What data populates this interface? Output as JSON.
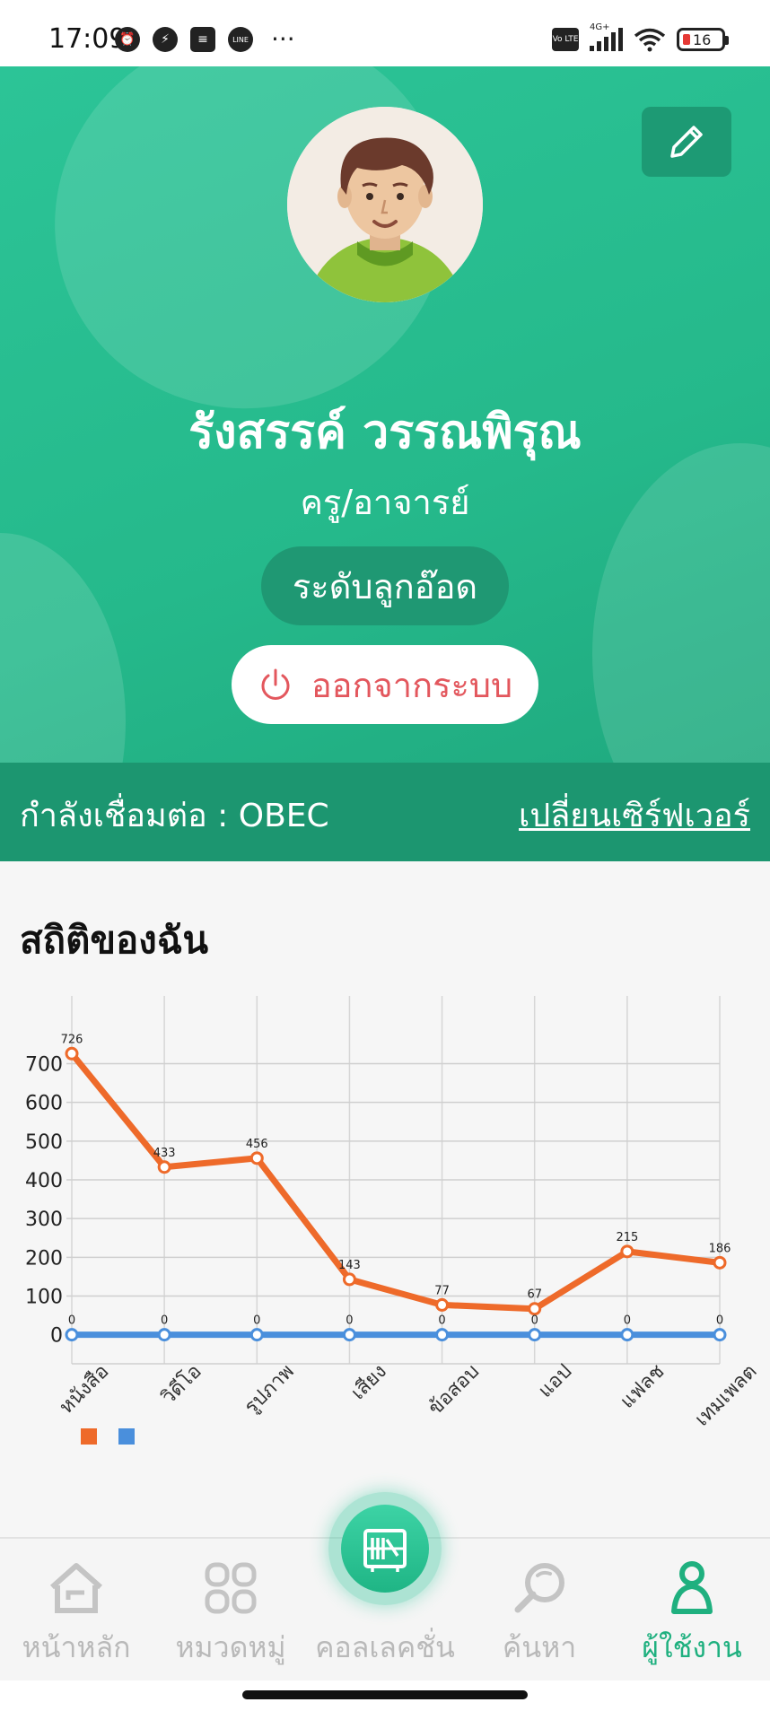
{
  "status_bar": {
    "time": "17:09",
    "left_icons": [
      "alarm-icon",
      "messenger-icon",
      "notes-icon",
      "line-icon"
    ],
    "more": "···",
    "volte": "Vo LTE",
    "network": "4G+",
    "battery": "16"
  },
  "profile": {
    "name": "รังสรรค์ วรรณพิรุณ",
    "role": "ครู/อาจารย์",
    "level": "ระดับลูกอ๊อด",
    "logout_label": "ออกจากระบบ"
  },
  "connection": {
    "label": "กำลังเชื่อมต่อ : OBEC",
    "switch_server": "เปลี่ยนเซิร์ฟเวอร์"
  },
  "stats": {
    "title": "สถิติของฉัน"
  },
  "chart_data": {
    "type": "line",
    "categories": [
      "หนังสือ",
      "วิดีโอ",
      "รูปภาพ",
      "เสียง",
      "ข้อสอบ",
      "แอป",
      "แฟลช",
      "เทมเพลต"
    ],
    "series": [
      {
        "values": [
          726,
          433,
          456,
          143,
          77,
          67,
          215,
          186
        ],
        "color": "#ee6a2a"
      },
      {
        "values": [
          0,
          0,
          0,
          0,
          0,
          0,
          0,
          0
        ],
        "color": "#4a8fdc"
      }
    ],
    "y_ticks": [
      0,
      100,
      200,
      300,
      400,
      500,
      600,
      700
    ],
    "ylim": [
      -75,
      875
    ],
    "grid": true,
    "legend": "bottom-left"
  },
  "nav": {
    "items": [
      {
        "label": "หน้าหลัก",
        "icon": "home-icon"
      },
      {
        "label": "หมวดหมู่",
        "icon": "category-icon"
      },
      {
        "label": "คอลเลคชั่น",
        "icon": "collection-icon"
      },
      {
        "label": "ค้นหา",
        "icon": "search-icon"
      },
      {
        "label": "ผู้ใช้งาน",
        "icon": "user-icon"
      }
    ],
    "active_color": "#1fb07f",
    "inactive_color": "#b9b9b9"
  }
}
